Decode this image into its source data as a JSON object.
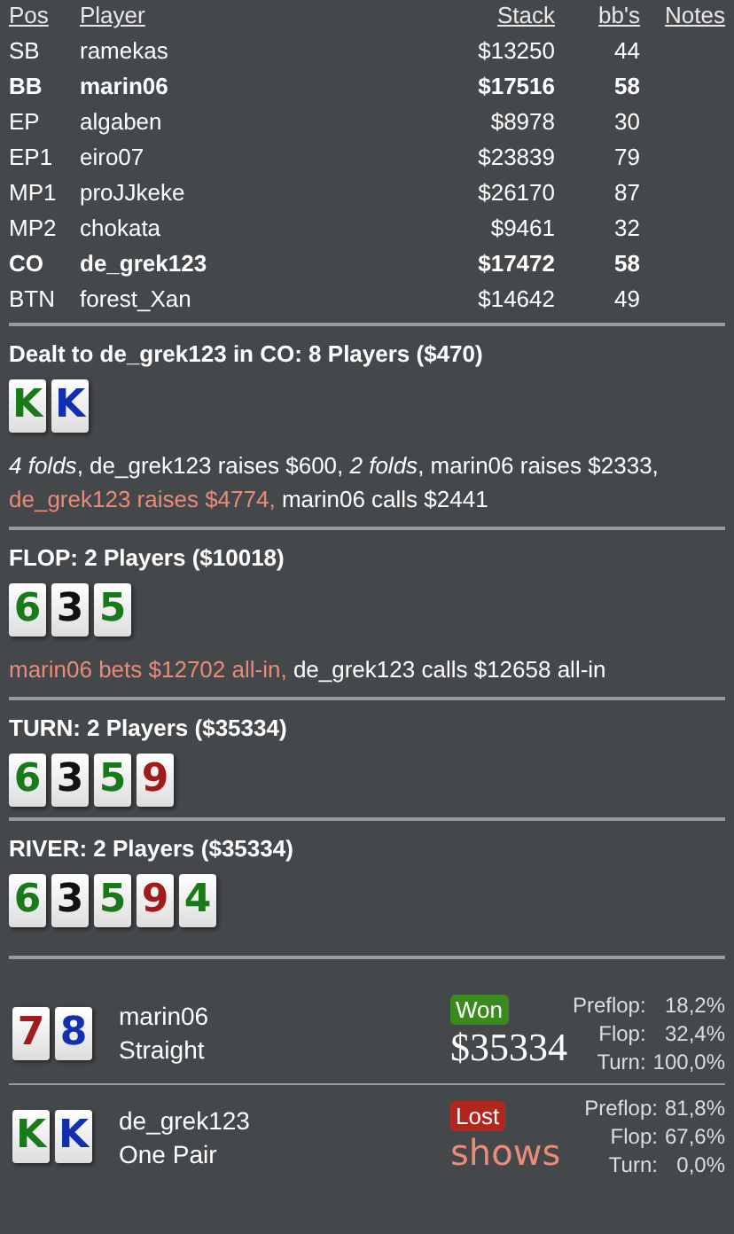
{
  "table": {
    "columns": [
      "Pos",
      "Player",
      "Stack",
      "bb's",
      "Notes"
    ],
    "rows": [
      {
        "pos": "SB",
        "player": "ramekas",
        "stack": "$13250",
        "bbs": "44",
        "bold": false
      },
      {
        "pos": "BB",
        "player": "marin06",
        "stack": "$17516",
        "bbs": "58",
        "bold": true
      },
      {
        "pos": "EP",
        "player": "algaben",
        "stack": "$8978",
        "bbs": "30",
        "bold": false
      },
      {
        "pos": "EP1",
        "player": "eiro07",
        "stack": "$23839",
        "bbs": "79",
        "bold": false
      },
      {
        "pos": "MP1",
        "player": "proJJkeke",
        "stack": "$26170",
        "bbs": "87",
        "bold": false
      },
      {
        "pos": "MP2",
        "player": "chokata",
        "stack": "$9461",
        "bbs": "32",
        "bold": false
      },
      {
        "pos": "CO",
        "player": "de_grek123",
        "stack": "$17472",
        "bbs": "58",
        "bold": true
      },
      {
        "pos": "BTN",
        "player": "forest_Xan",
        "stack": "$14642",
        "bbs": "49",
        "bold": false
      }
    ]
  },
  "streets": [
    {
      "heading": "Dealt to de_grek123 in CO: 8 Players ($470)",
      "cards": [
        {
          "rank": "K",
          "color": "#1a7a1a"
        },
        {
          "rank": "K",
          "color": "#1030b0"
        }
      ],
      "actions": [
        {
          "text": "4 folds",
          "italic": true,
          "highlight": false
        },
        {
          "text": ", de_grek123 raises $600, ",
          "italic": false,
          "highlight": false
        },
        {
          "text": "2 folds",
          "italic": true,
          "highlight": false
        },
        {
          "text": ", marin06 raises $2333, ",
          "italic": false,
          "highlight": false
        },
        {
          "text": "de_grek123 raises $4774, ",
          "italic": false,
          "highlight": true
        },
        {
          "text": "marin06 calls $2441",
          "italic": false,
          "highlight": false
        }
      ]
    },
    {
      "heading": "FLOP: 2 Players ($10018)",
      "cards": [
        {
          "rank": "6",
          "color": "#1a7a1a"
        },
        {
          "rank": "3",
          "color": "#111111"
        },
        {
          "rank": "5",
          "color": "#1a7a1a"
        }
      ],
      "actions": [
        {
          "text": "marin06 bets $12702 all-in, ",
          "italic": false,
          "highlight": true
        },
        {
          "text": "de_grek123 calls $12658 all-in",
          "italic": false,
          "highlight": false
        }
      ]
    },
    {
      "heading": "TURN: 2 Players ($35334)",
      "cards": [
        {
          "rank": "6",
          "color": "#1a7a1a"
        },
        {
          "rank": "3",
          "color": "#111111"
        },
        {
          "rank": "5",
          "color": "#1a7a1a"
        },
        {
          "rank": "9",
          "color": "#a01c1c"
        }
      ]
    },
    {
      "heading": "RIVER: 2 Players ($35334)",
      "cards": [
        {
          "rank": "6",
          "color": "#1a7a1a"
        },
        {
          "rank": "3",
          "color": "#111111"
        },
        {
          "rank": "5",
          "color": "#1a7a1a"
        },
        {
          "rank": "9",
          "color": "#a01c1c"
        },
        {
          "rank": "4",
          "color": "#1a7a1a"
        }
      ]
    }
  ],
  "results": [
    {
      "cards": [
        {
          "rank": "7",
          "color": "#a01c1c"
        },
        {
          "rank": "8",
          "color": "#1030b0"
        }
      ],
      "player": "marin06",
      "hand": "Straight",
      "won": true,
      "badge": "Won",
      "amount": "$35334",
      "equity": [
        {
          "label": "Preflop:",
          "value": "18,2%"
        },
        {
          "label": "Flop:",
          "value": "32,4%"
        },
        {
          "label": "Turn:",
          "value": "100,0%"
        }
      ]
    },
    {
      "cards": [
        {
          "rank": "K",
          "color": "#1a7a1a"
        },
        {
          "rank": "K",
          "color": "#1030b0"
        }
      ],
      "player": "de_grek123",
      "hand": "One Pair",
      "won": false,
      "badge": "Lost",
      "amount": "shows",
      "equity": [
        {
          "label": "Preflop:",
          "value": "81,8%"
        },
        {
          "label": "Flop:",
          "value": "67,6%"
        },
        {
          "label": "Turn:",
          "value": "0,0%"
        }
      ]
    }
  ]
}
